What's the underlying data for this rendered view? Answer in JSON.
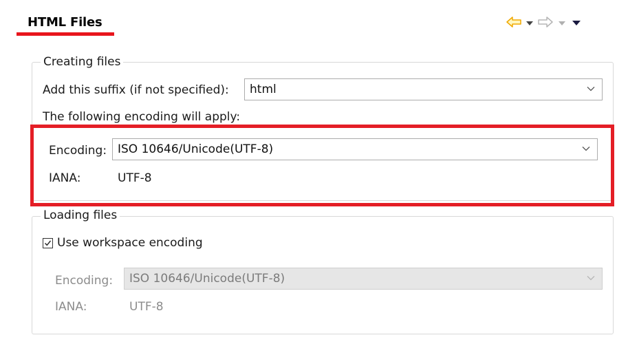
{
  "page": {
    "title": "HTML Files"
  },
  "toolbar": {
    "back_icon": "back-arrow-icon",
    "forward_icon": "forward-arrow-icon",
    "menu_icon": "view-menu-icon"
  },
  "creating": {
    "legend": "Creating files",
    "suffix_label": "Add this suffix (if not specified):",
    "suffix_value": "html",
    "encoding_note": "The following encoding will apply:",
    "encoding_label": "Encoding:",
    "encoding_value": "ISO 10646/Unicode(UTF-8)",
    "iana_label": "IANA:",
    "iana_value": "UTF-8"
  },
  "loading": {
    "legend": "Loading files",
    "use_workspace_label": "Use workspace encoding",
    "use_workspace_checked": true,
    "encoding_label": "Encoding:",
    "encoding_value": "ISO 10646/Unicode(UTF-8)",
    "iana_label": "IANA:",
    "iana_value": "UTF-8"
  },
  "colors": {
    "highlight": "#e41e26",
    "arrow_back": "#f0a800",
    "arrow_forward": "#b5b5b5",
    "disabled_text": "#8c8c8c"
  }
}
